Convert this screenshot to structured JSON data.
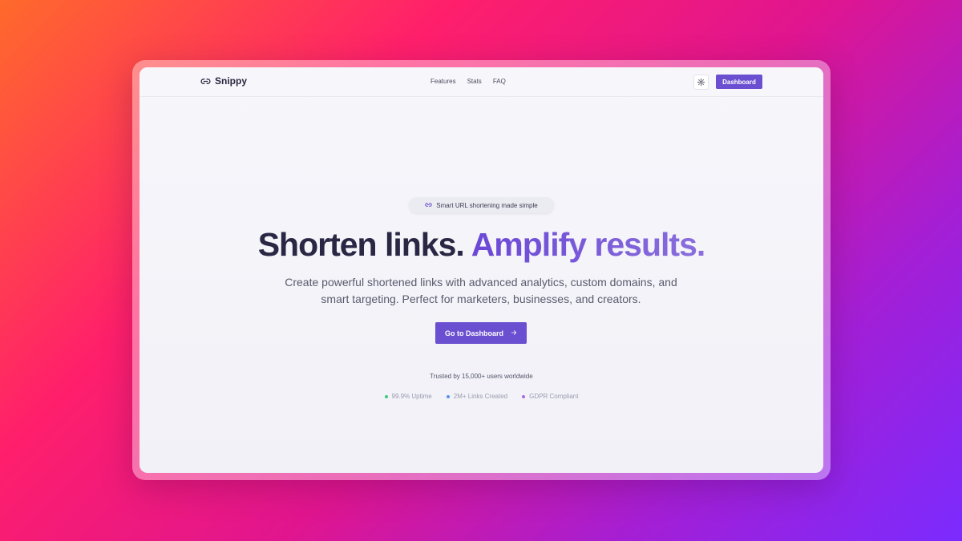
{
  "brand": {
    "name": "Snippy",
    "icon": "link-icon"
  },
  "nav": {
    "items": [
      "Features",
      "Stats",
      "FAQ"
    ]
  },
  "header": {
    "theme_icon": "sun-icon",
    "dashboard_label": "Dashboard"
  },
  "hero": {
    "badge": "Smart URL shortening made simple",
    "title_main": "Shorten links.",
    "title_accent": "Amplify results.",
    "subtitle_line1": "Create powerful shortened links with advanced analytics, custom domains, and",
    "subtitle_line2": "smart targeting. Perfect for marketers, businesses, and creators.",
    "cta_label": "Go to Dashboard",
    "trusted": "Trusted by 15,000+ users worldwide"
  },
  "stats": [
    {
      "label": "99.9% Uptime",
      "color": "#3ec97a"
    },
    {
      "label": "2M+ Links Created",
      "color": "#5b8ff0"
    },
    {
      "label": "GDPR Compliant",
      "color": "#a46be8"
    }
  ],
  "colors": {
    "accent": "#6a4fd0",
    "title": "#2a2744"
  }
}
